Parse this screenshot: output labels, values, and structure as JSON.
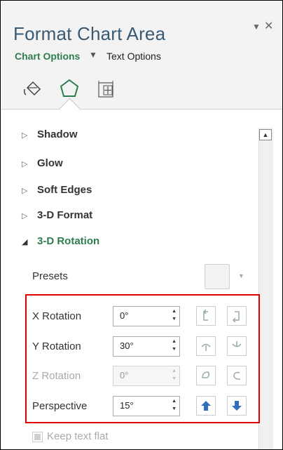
{
  "pane": {
    "title": "Format Chart Area",
    "tabs": {
      "chart_options": "Chart Options",
      "text_options": "Text Options"
    },
    "icons": [
      "fill-line-icon",
      "effects-icon",
      "size-properties-icon"
    ]
  },
  "sections": [
    {
      "label": "Shadow",
      "expanded": false
    },
    {
      "label": "Glow",
      "expanded": false
    },
    {
      "label": "Soft Edges",
      "expanded": false
    },
    {
      "label": "3-D Format",
      "expanded": false
    },
    {
      "label": "3-D Rotation",
      "expanded": true
    }
  ],
  "rotation": {
    "presets_label": "Presets",
    "x": {
      "label": "X Rotation",
      "value": "0°"
    },
    "y": {
      "label": "Y Rotation",
      "value": "30°"
    },
    "z": {
      "label": "Z Rotation",
      "value": "0°",
      "disabled": true
    },
    "perspective": {
      "label": "Perspective",
      "value": "15°"
    },
    "keep_text_flat": {
      "label": "Keep text flat",
      "checked": false,
      "disabled": true
    }
  },
  "colors": {
    "accent_green": "#2e7d4f",
    "title_blue": "#3a5a74",
    "highlight_red": "#e00000",
    "button_blue": "#2e6fbe"
  }
}
